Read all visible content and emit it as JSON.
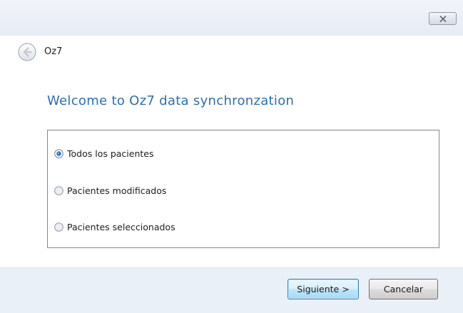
{
  "window": {
    "close_icon": "close-x-icon"
  },
  "header": {
    "back_icon": "back-arrow-icon",
    "app_name": "Oz7"
  },
  "main": {
    "title": "Welcome to Oz7 data synchronzation",
    "options": [
      {
        "label": "Todos los pacientes",
        "selected": true
      },
      {
        "label": "Pacientes modificados",
        "selected": false
      },
      {
        "label": "Pacientes seleccionados",
        "selected": false
      }
    ]
  },
  "footer": {
    "next_label": "Siguiente >",
    "cancel_label": "Cancelar"
  },
  "colors": {
    "title_blue": "#2f6fa7",
    "footer_bg": "#eaf0f7",
    "radio_selected": "#2b72c8"
  }
}
